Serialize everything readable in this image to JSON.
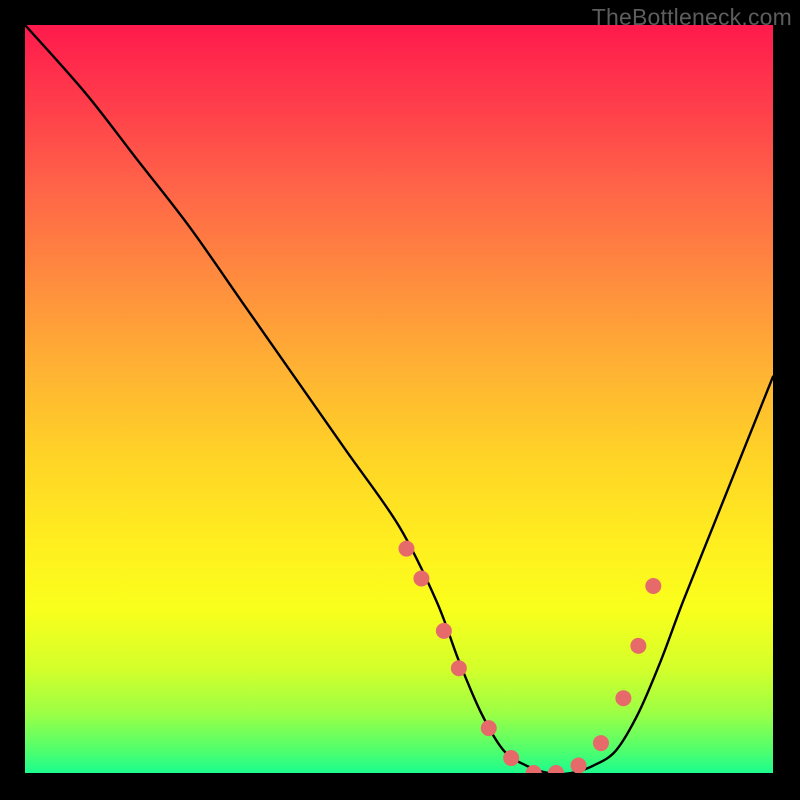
{
  "watermark": "TheBottleneck.com",
  "chart_data": {
    "type": "line",
    "title": "",
    "xlabel": "",
    "ylabel": "",
    "xlim": [
      0,
      100
    ],
    "ylim": [
      0,
      100
    ],
    "series": [
      {
        "name": "bottleneck-curve",
        "x": [
          0,
          8,
          15,
          22,
          29,
          36,
          43,
          50,
          55,
          58,
          61,
          64,
          67,
          70,
          73,
          76,
          79,
          82,
          85,
          88,
          92,
          96,
          100
        ],
        "values": [
          100,
          91,
          82,
          73,
          63,
          53,
          43,
          33,
          23,
          15,
          8,
          3,
          1,
          0,
          0,
          1,
          3,
          8,
          15,
          23,
          33,
          43,
          53
        ]
      }
    ],
    "markers": {
      "name": "highlight-points",
      "x": [
        51,
        53,
        56,
        58,
        62,
        65,
        68,
        71,
        74,
        77,
        80,
        82,
        84
      ],
      "values": [
        30,
        26,
        19,
        14,
        6,
        2,
        0,
        0,
        1,
        4,
        10,
        17,
        25
      ],
      "color": "#e76a6a",
      "radius": 8
    },
    "gradient_stops": [
      {
        "pos": 0,
        "color": "#ff1a4c"
      },
      {
        "pos": 10,
        "color": "#ff3b4b"
      },
      {
        "pos": 22,
        "color": "#ff6548"
      },
      {
        "pos": 34,
        "color": "#ff8c3e"
      },
      {
        "pos": 46,
        "color": "#ffb233"
      },
      {
        "pos": 58,
        "color": "#ffd426"
      },
      {
        "pos": 70,
        "color": "#fff01f"
      },
      {
        "pos": 78,
        "color": "#faff1c"
      },
      {
        "pos": 86,
        "color": "#d4ff2a"
      },
      {
        "pos": 92,
        "color": "#9cff45"
      },
      {
        "pos": 97,
        "color": "#4fff6d"
      },
      {
        "pos": 100,
        "color": "#1cfc8e"
      }
    ]
  }
}
